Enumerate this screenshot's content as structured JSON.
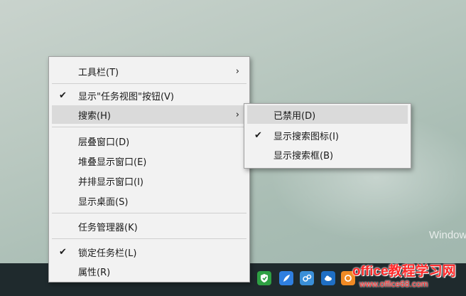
{
  "desktop": {
    "watermark": "Window"
  },
  "context_menu": {
    "items": [
      {
        "label": "工具栏(T)",
        "submenu_arrow": "›"
      },
      {
        "label": "显示\"任务视图\"按钮(V)",
        "check": "✔"
      },
      {
        "label": "搜索(H)",
        "submenu_arrow": "›"
      },
      {
        "label": "层叠窗口(D)"
      },
      {
        "label": "堆叠显示窗口(E)"
      },
      {
        "label": "并排显示窗口(I)"
      },
      {
        "label": "显示桌面(S)"
      },
      {
        "label": "任务管理器(K)"
      },
      {
        "label": "锁定任务栏(L)",
        "check": "✔"
      },
      {
        "label": "属性(R)"
      }
    ]
  },
  "search_submenu": {
    "items": [
      {
        "label": "已禁用(D)"
      },
      {
        "label": "显示搜索图标(I)",
        "check": "✔"
      },
      {
        "label": "显示搜索框(B)"
      }
    ]
  },
  "taskbar": {
    "tray_icons": [
      "shield-icon",
      "feather-icon",
      "network-icon",
      "cloud-icon",
      "orange-app-icon"
    ]
  },
  "site_watermark": {
    "name": "office教程学习网",
    "url": "www.office68.com"
  },
  "colors": {
    "menu_bg": "#f2f2f2",
    "highlight": "#dadada",
    "taskbar": "#1f2a2d",
    "watermark_red": "#ff2a2a"
  }
}
